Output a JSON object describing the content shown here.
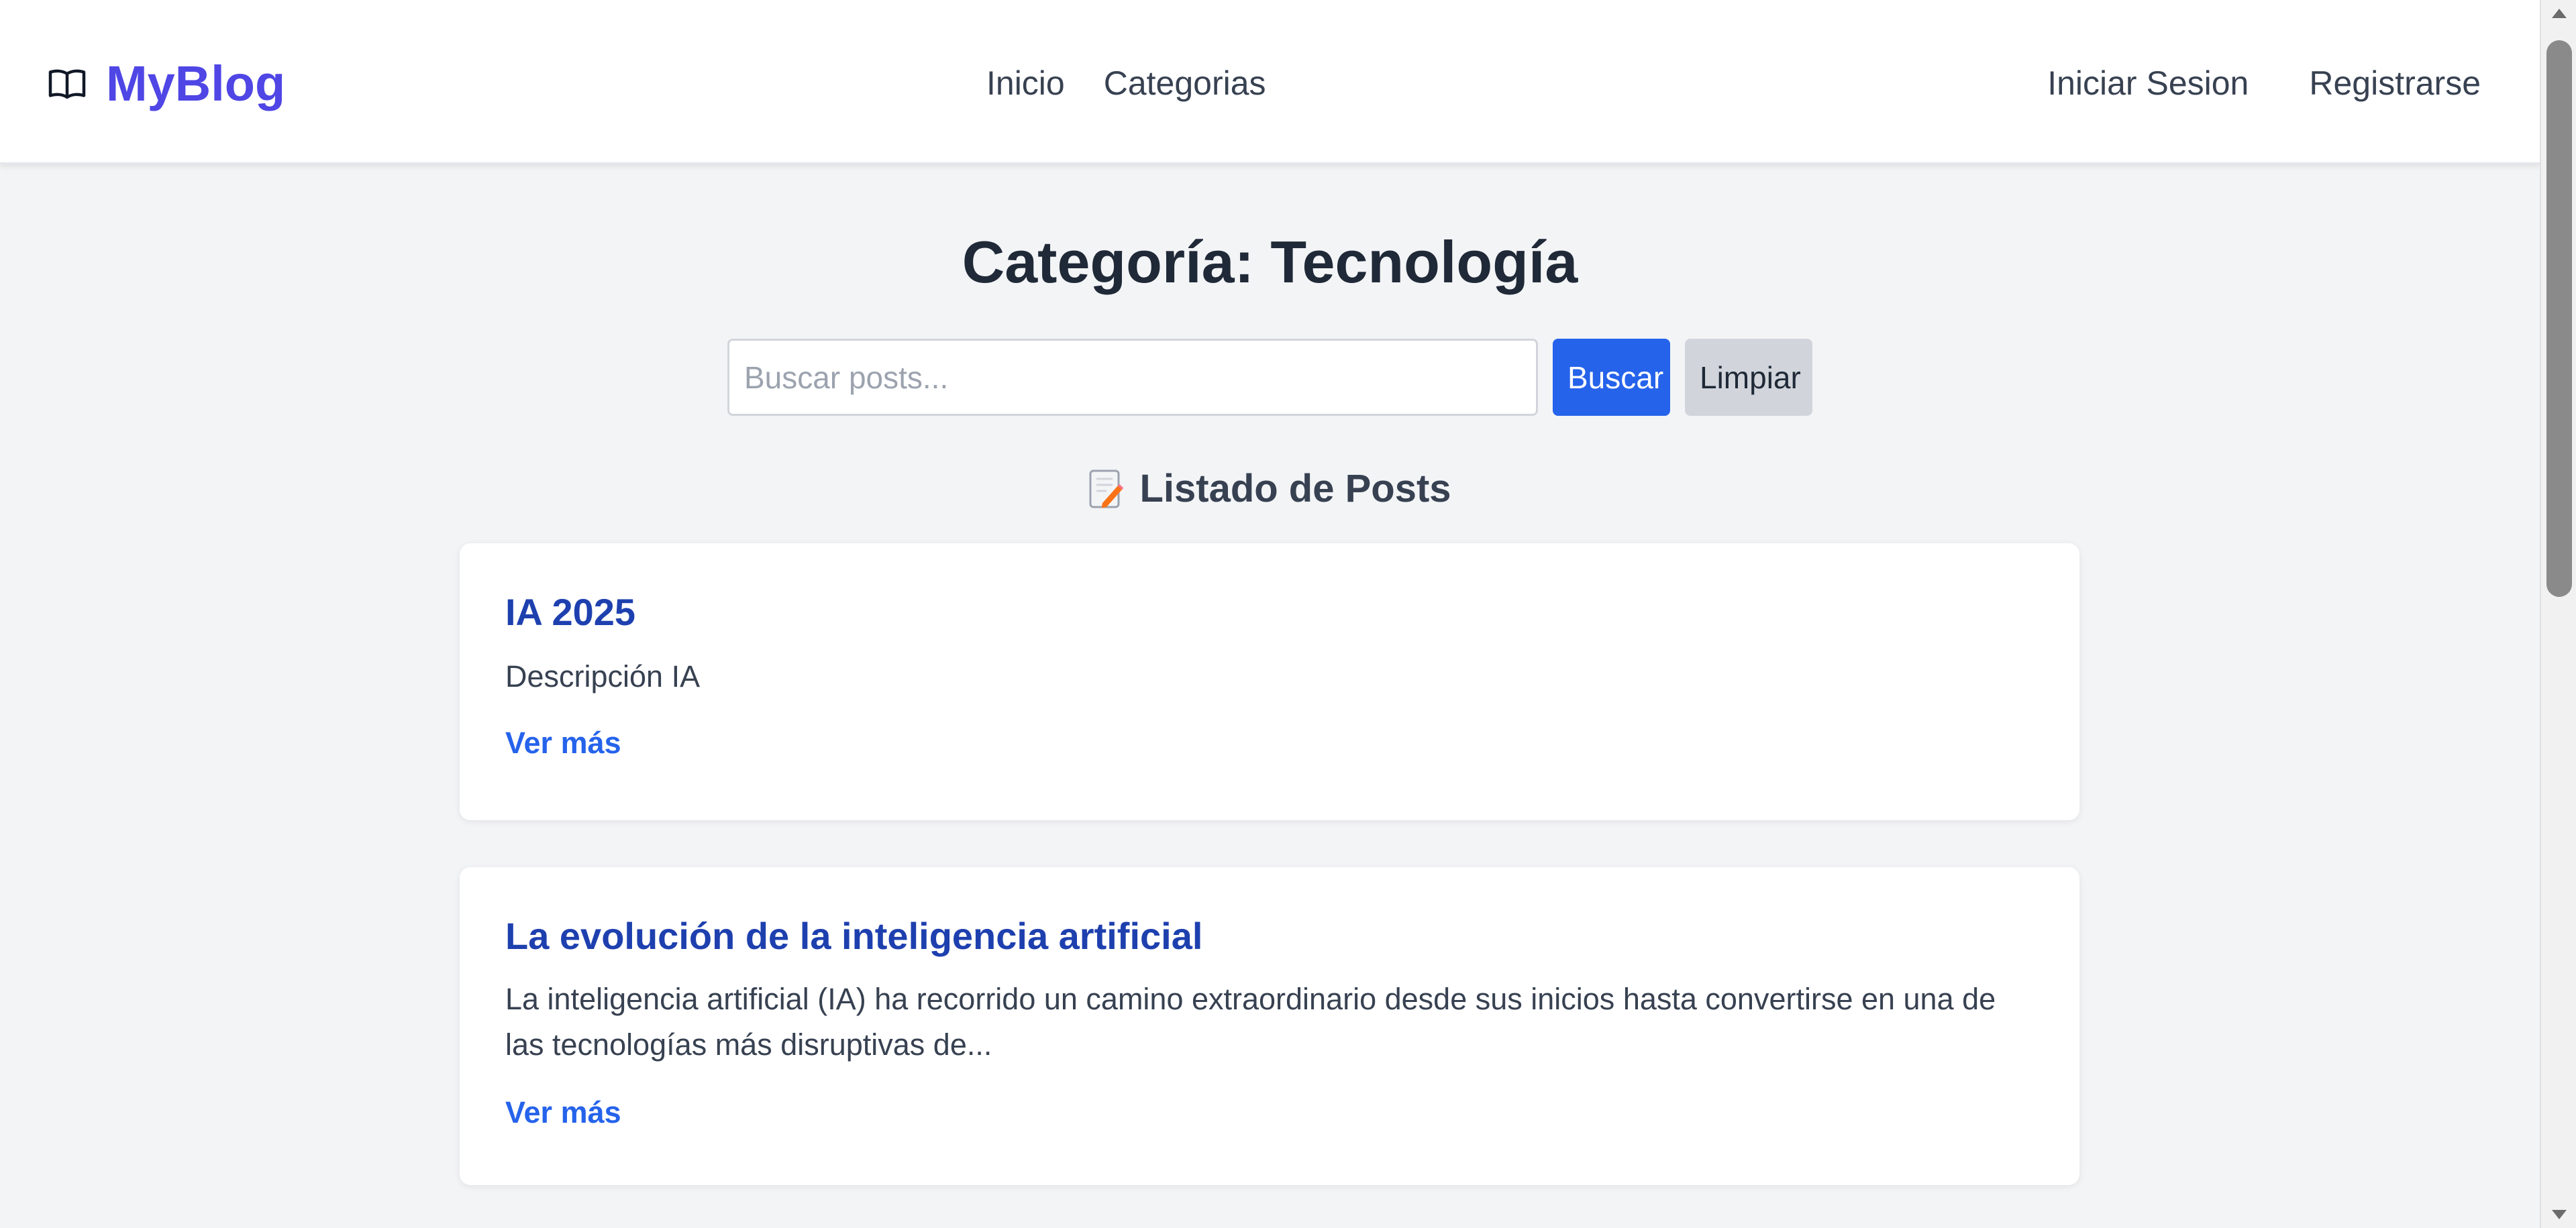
{
  "header": {
    "brand_name": "MyBlog",
    "brand_icon": "open-book-icon",
    "nav_center": [
      {
        "label": "Inicio"
      },
      {
        "label": "Categorias"
      }
    ],
    "nav_right": [
      {
        "label": "Iniciar Sesion"
      },
      {
        "label": "Registrarse"
      }
    ]
  },
  "main": {
    "page_title": "Categoría: Tecnología",
    "search": {
      "placeholder": "Buscar posts...",
      "value": "",
      "search_button": "Buscar",
      "clear_button": "Limpiar"
    },
    "section_icon": "memo-icon",
    "section_title": "Listado de Posts",
    "posts": [
      {
        "title": "IA 2025",
        "description": "Descripción IA",
        "link_label": "Ver más"
      },
      {
        "title": "La evolución de la inteligencia artificial",
        "description": "La inteligencia artificial (IA) ha recorrido un camino extraordinario desde sus inicios hasta convertirse en una de las tecnologías más disruptivas de...",
        "link_label": "Ver más"
      }
    ]
  },
  "colors": {
    "brand": "#4f46e5",
    "primary_button": "#2563eb",
    "secondary_button": "#d1d5db",
    "post_title": "#1e40af",
    "link": "#2563eb",
    "background": "#f3f4f6"
  }
}
